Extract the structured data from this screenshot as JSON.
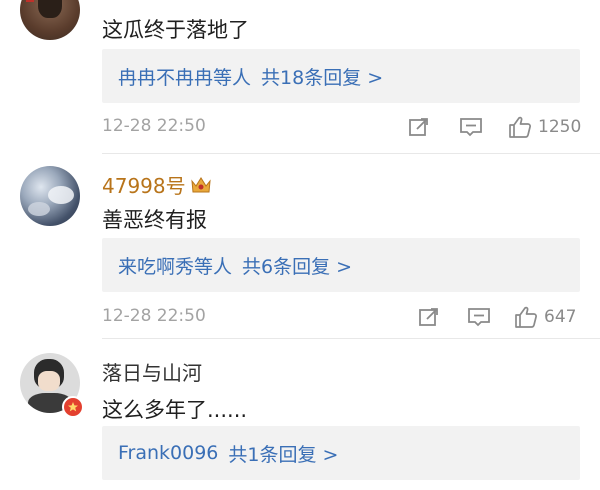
{
  "comments": [
    {
      "name": "",
      "text": "这瓜终于落地了",
      "reply_who": "冉冉不冉冉等人",
      "reply_count": "共18条回复 >",
      "time": "12-28 22:50",
      "likes": "1250",
      "avatar_color": "#6b4a3a"
    },
    {
      "name": "47998号",
      "text": "善恶终有报",
      "reply_who": "来吃啊秀等人",
      "reply_count": "共6条回复 >",
      "time": "12-28 22:50",
      "likes": "647",
      "avatar_color": "#4a5a70"
    },
    {
      "name": "落日与山河",
      "text": "这么多年了......",
      "reply_who": "Frank0096",
      "reply_count": "共1条回复 >",
      "avatar_color": "#d9d9d9"
    }
  ],
  "icons": {
    "share": "share-icon",
    "reply": "comment-icon",
    "like": "thumbs-up-icon",
    "vip": "crown-badge-icon",
    "verified": "verified-badge-icon"
  },
  "colors": {
    "name_vip": "#b8741a",
    "link_blue": "#3a6fb6",
    "reply_bg": "#f2f2f2",
    "meta_gray": "#a3a3a3"
  }
}
